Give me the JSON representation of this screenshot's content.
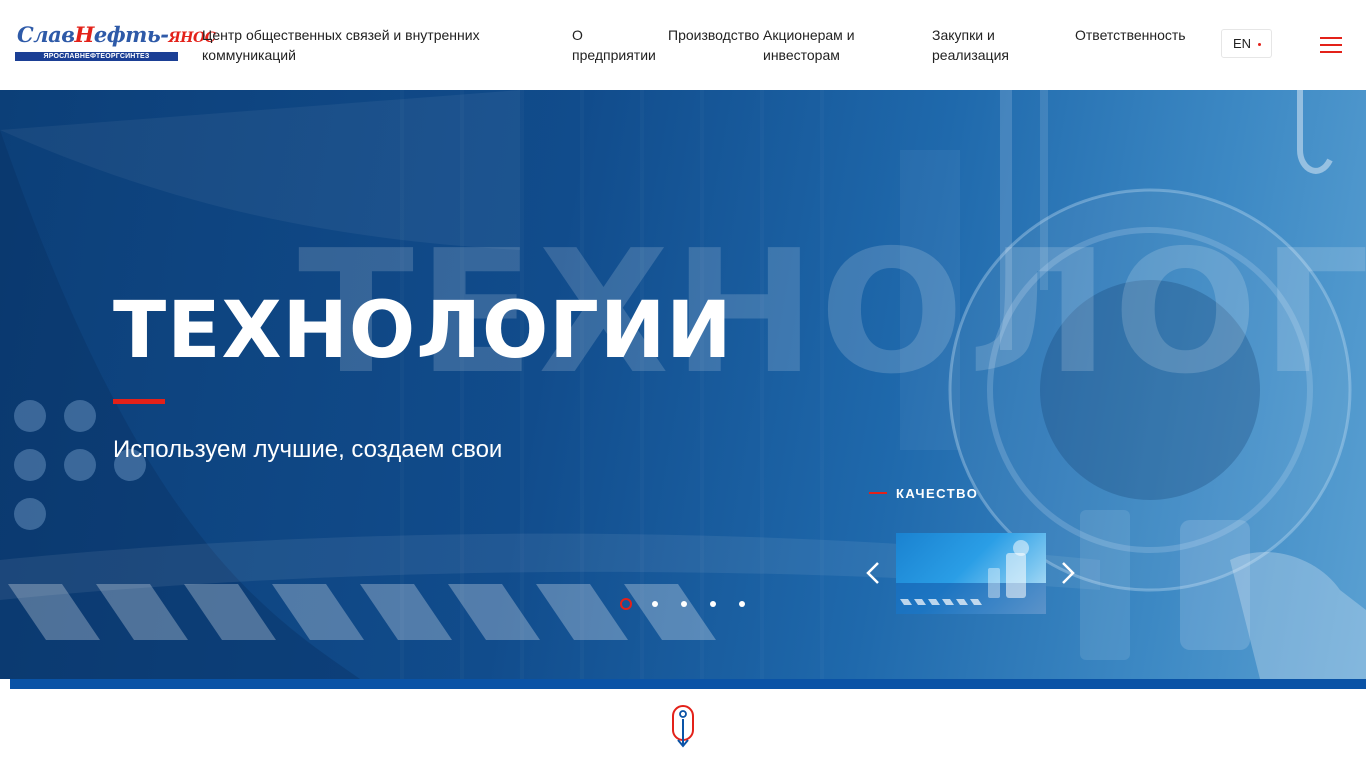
{
  "brand": {
    "logo_word_blue": "Слав",
    "logo_word_mid": "Н",
    "logo_word_rest": "ефть-",
    "logo_word_red": "ЯНОС",
    "logo_subtitle": "ЯРОСЛАВНЕФТЕОРГСИНТЕЗ",
    "accent_red": "#e32119",
    "accent_blue": "#0a53a6"
  },
  "header": {
    "center_title": "Центр общественных связей и внутренних коммуникаций",
    "nav": [
      {
        "label": "О предприятии"
      },
      {
        "label": "Производство"
      },
      {
        "label": "Акционерам и инвесторам"
      },
      {
        "label": "Закупки и реализация"
      },
      {
        "label": "Ответственность"
      }
    ],
    "lang": "EN",
    "menu_icon": "hamburger-menu-icon"
  },
  "hero": {
    "ghost_text": "ТЕХНОЛОГИИ",
    "title": "ТЕХНОЛОГИИ",
    "subtitle": "Используем лучшие, создаем свои",
    "next_slide_label": "КАЧЕСТВО",
    "slide_count": 5,
    "active_slide": 1,
    "prev_icon": "chevron-left-icon",
    "next_icon": "chevron-right-icon"
  },
  "scroll_icon": "scroll-down-icon"
}
